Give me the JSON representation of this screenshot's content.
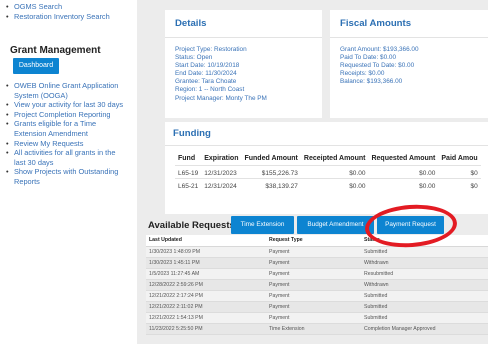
{
  "sidebar": {
    "top_links": [
      "OGMS Search",
      "Restoration Inventory Search"
    ],
    "heading": "Grant Management",
    "dashboard_button": "Dashboard",
    "links": [
      "OWEB Online Grant Application System (OOGA)",
      "View your activity for last 30 days",
      "Project Completion Reporting",
      "Grants eligible for a Time Extension Amendment",
      "Review My Requests",
      "All activities for all grants in the last 30 days",
      "Show Projects with Outstanding Reports"
    ]
  },
  "details": {
    "title": "Details",
    "project_type": "Project Type: Restoration",
    "status": "Status: Open",
    "start_date": "Start Date: 10/19/2018",
    "end_date": "End Date: 11/30/2024",
    "grantee": "Grantee: Tara Choate",
    "region": "Region: 1 -- North Coast",
    "project_manager": "Project Manager: Monty The PM"
  },
  "fiscal": {
    "title": "Fiscal Amounts",
    "grant_amount": "Grant Amount: $193,366.00",
    "paid_to_date": "Paid To Date: $0.00",
    "requested_to_date": "Requested To Date: $0.00",
    "receipts": "Receipts: $0.00",
    "balance": "Balance: $193,366.00"
  },
  "funding": {
    "title": "Funding",
    "headers": [
      "Fund",
      "Expiration",
      "Funded Amount",
      "Receipted Amount",
      "Requested Amount",
      "Paid Amou"
    ],
    "rows": [
      [
        "L65-19",
        "12/31/2023",
        "$155,226.73",
        "$0.00",
        "$0.00",
        "$0"
      ],
      [
        "L65-21",
        "12/31/2024",
        "$38,139.27",
        "$0.00",
        "$0.00",
        "$0"
      ]
    ]
  },
  "requests": {
    "label": "Available Requests:",
    "buttons": {
      "time_extension": "Time Extension",
      "budget_amendment": "Budget Amendment",
      "payment_request": "Payment Request"
    },
    "headers": [
      "Last Updated",
      "Request Type",
      "Status"
    ],
    "rows": [
      [
        "1/30/2023 1:48:09 PM",
        "Payment",
        "Submitted"
      ],
      [
        "1/30/2023 1:45:11 PM",
        "Payment",
        "Withdrawn"
      ],
      [
        "1/5/2023 11:27:45 AM",
        "Payment",
        "Resubmitted"
      ],
      [
        "12/28/2022 2:59:26 PM",
        "Payment",
        "Withdrawn"
      ],
      [
        "12/21/2022 2:17:24 PM",
        "Payment",
        "Submitted"
      ],
      [
        "12/21/2022 2:11:02 PM",
        "Payment",
        "Submitted"
      ],
      [
        "12/21/2022 1:54:13 PM",
        "Payment",
        "Submitted"
      ],
      [
        "11/23/2022 5:25:50 PM",
        "Time Extension",
        "Completion Manager Approved"
      ]
    ]
  },
  "colors": {
    "accent_blue": "#0d84d1",
    "link_blue": "#3a73b8",
    "annotation_red": "#e31b23"
  }
}
